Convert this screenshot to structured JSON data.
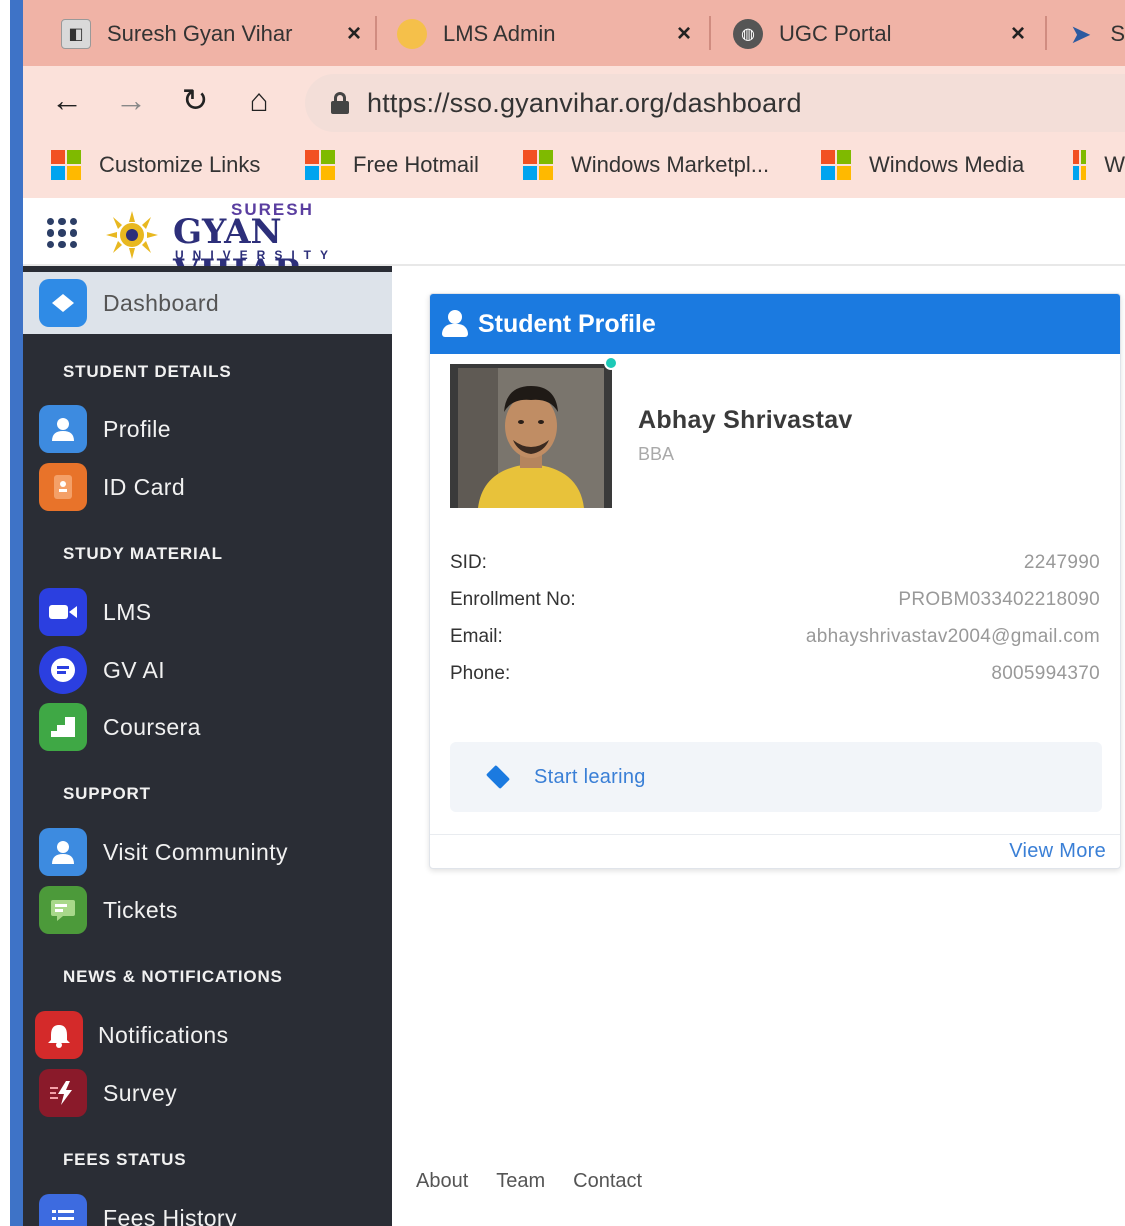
{
  "browser": {
    "tabs": [
      {
        "title": "Suresh Gyan Vihar",
        "close": "×",
        "favicon_color": "#d9d9d9"
      },
      {
        "title": "LMS Admin",
        "close": "×",
        "favicon_color": "#f5b84a"
      },
      {
        "title": "UGC Portal",
        "close": "×",
        "favicon_color": "#555555"
      },
      {
        "title": "S",
        "favicon_color": "#2c5aa0"
      }
    ],
    "url": "https://sso.gyanvihar.org/dashboard",
    "bookmarks": [
      "Customize Links",
      "Free Hotmail",
      "Windows Marketpl...",
      "Windows Media",
      "W"
    ]
  },
  "app": {
    "logo": {
      "top": "SURESH",
      "main": "GYAN VIHAR",
      "bottom": "UNIVERSITY"
    }
  },
  "sidebar": {
    "dashboard": "Dashboard",
    "sections": {
      "student_details": "STUDENT DETAILS",
      "study_material": "STUDY MATERIAL",
      "support": "SUPPORT",
      "news": "NEWS & NOTIFICATIONS",
      "fees": "FEES STATUS"
    },
    "items": {
      "profile": "Profile",
      "id_card": "ID Card",
      "lms": "LMS",
      "gv_ai": "GV AI",
      "coursera": "Coursera",
      "community": "Visit Communinty",
      "tickets": "Tickets",
      "notifications": "Notifications",
      "survey": "Survey",
      "fees_history": "Fees History"
    },
    "icon_colors": {
      "dashboard": "#2f8be6",
      "profile": "#3d8be0",
      "id_card": "#e8732a",
      "lms": "#2b3fe0",
      "gv_ai": "#2b3fe0",
      "coursera": "#3fa845",
      "community": "#3d8be0",
      "tickets": "#4c9a3a",
      "notifications": "#d42a2a",
      "survey": "#8a1a2a",
      "fees_history": "#3d6be0"
    }
  },
  "profile_card": {
    "title": "Student Profile",
    "name": "Abhay Shrivastav",
    "program": "BBA",
    "fields": [
      {
        "label": "SID:",
        "value": "2247990"
      },
      {
        "label": "Enrollment No:",
        "value": "PROBM033402218090"
      },
      {
        "label": "Email:",
        "value": "abhayshrivastav2004@gmail.com"
      },
      {
        "label": "Phone:",
        "value": "8005994370"
      }
    ],
    "start_button": "Start learing",
    "view_more": "View More",
    "accent": "#1b7ae0"
  },
  "footer": {
    "about": "About",
    "team": "Team",
    "contact": "Contact"
  }
}
